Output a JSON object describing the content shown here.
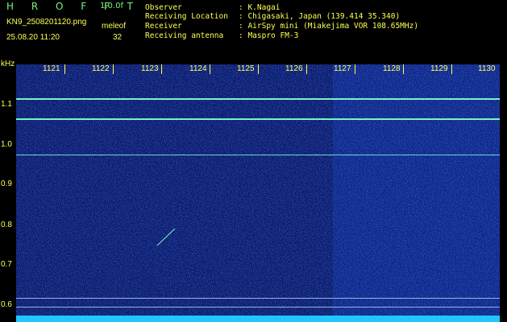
{
  "header": {
    "brand": "H R O F F T",
    "version": "1.0.0f",
    "filename": "KN9_2508201120.png",
    "meleof_label": "meleof",
    "datetime": "25.08.20 11:20",
    "meleof_value": "32"
  },
  "meta": [
    {
      "key": "Observer",
      "value": ": K.Nagai"
    },
    {
      "key": "Receiving Location",
      "value": ": Chigasaki, Japan (139.414 35.340)"
    },
    {
      "key": "Receiver",
      "value": ": AirSpy mini (Miakejima VOR 108.65MHz)"
    },
    {
      "key": "Receiving antenna",
      "value": ": Maspro FM-3"
    }
  ],
  "axes": {
    "unit": "kHz",
    "y_labels": [
      "1.1",
      "1.0",
      "0.9",
      "0.8",
      "0.7",
      "0.6"
    ],
    "x_labels": [
      "1121",
      "1122",
      "1123",
      "1124",
      "1125",
      "1126",
      "1127",
      "1128",
      "1129",
      "1130"
    ]
  },
  "colors": {
    "text": "#ffff55",
    "brand": "#7cf27c",
    "background": "#0c1a6e",
    "signal": "#7df0c8",
    "baseline": "#22c6ff"
  }
}
